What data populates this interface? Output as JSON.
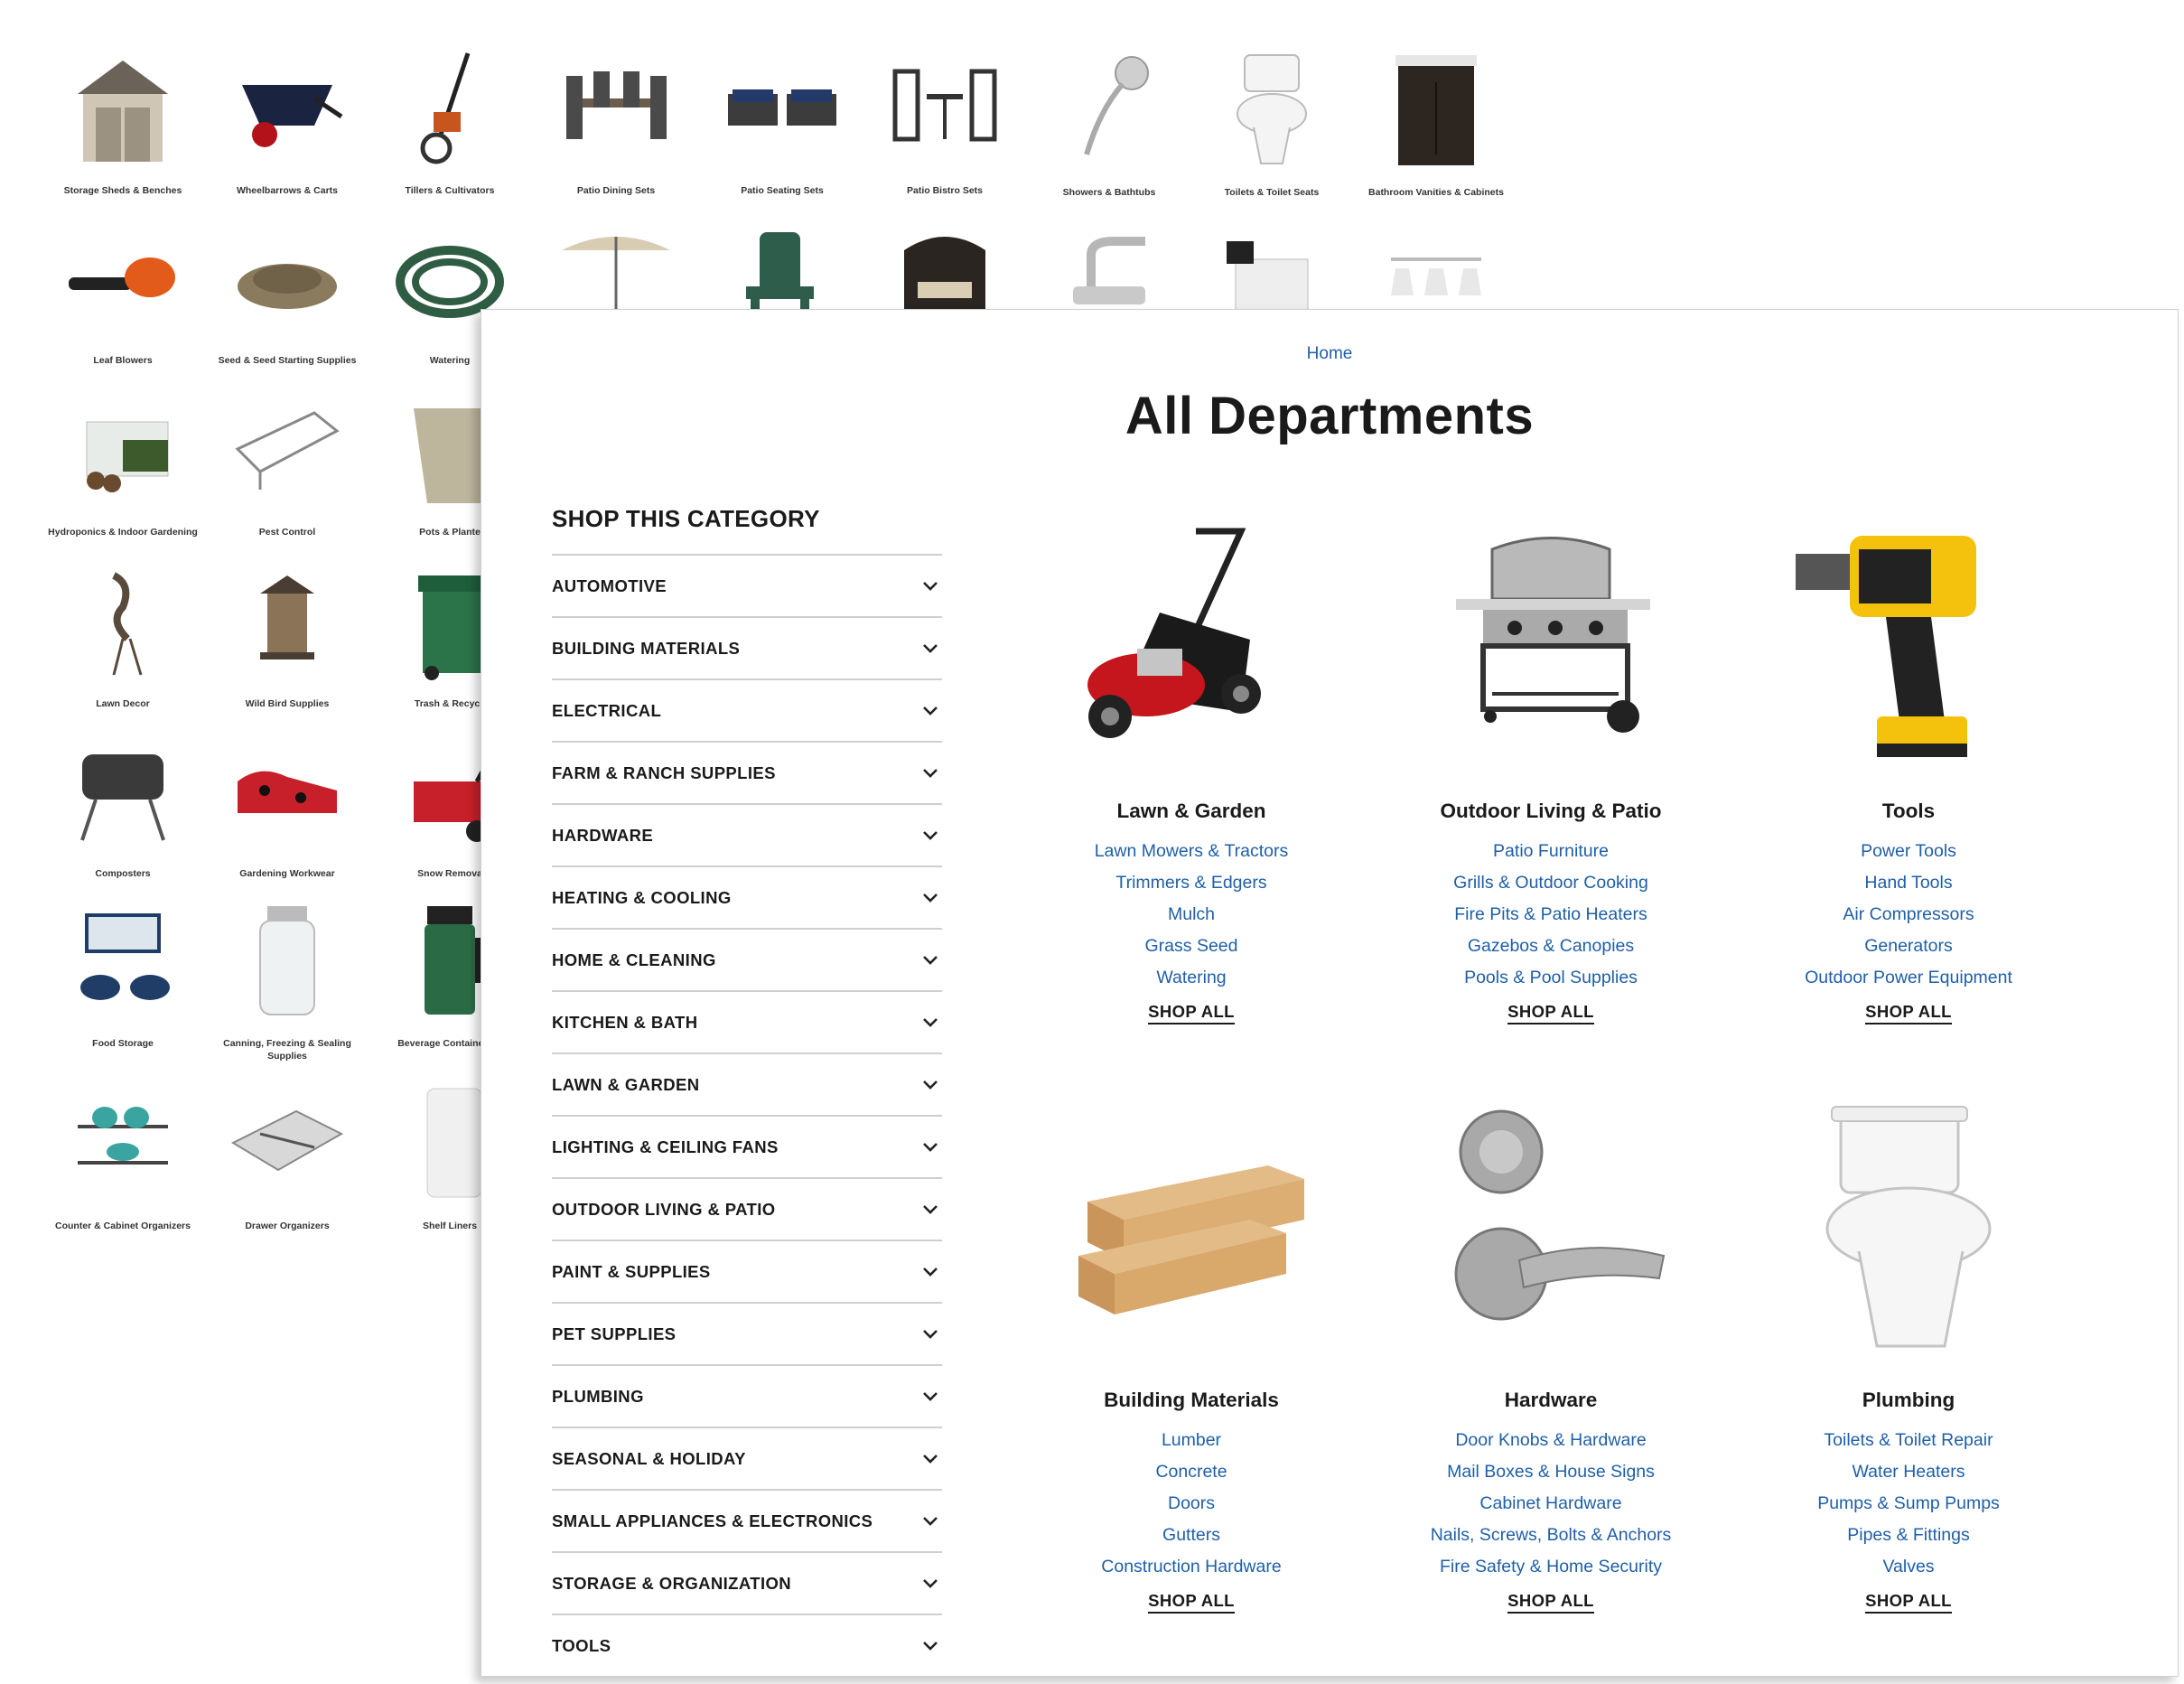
{
  "background_grid": {
    "tiles": [
      {
        "caption": "Storage Sheds & Benches",
        "icon": "shed-icon"
      },
      {
        "caption": "Wheelbarrows & Carts",
        "icon": "wheelbarrow-icon"
      },
      {
        "caption": "Tillers & Cultivators",
        "icon": "tiller-icon"
      },
      {
        "caption": "Patio Dining Sets",
        "icon": "patio-dining-icon"
      },
      {
        "caption": "Patio Seating Sets",
        "icon": "patio-seating-icon"
      },
      {
        "caption": "Patio Bistro Sets",
        "icon": "bistro-set-icon"
      },
      {
        "caption": "Showers & Bathtubs",
        "icon": "shower-head-icon"
      },
      {
        "caption": "Toilets & Toilet Seats",
        "icon": "toilet-icon"
      },
      {
        "caption": "Bathroom Vanities & Cabinets",
        "icon": "vanity-icon"
      },
      {
        "caption": "Leaf Blowers",
        "icon": "leaf-blower-icon"
      },
      {
        "caption": "Seed & Seed Starting Supplies",
        "icon": "seed-icon"
      },
      {
        "caption": "Watering",
        "icon": "hose-icon"
      },
      {
        "caption": "",
        "icon": "umbrella-icon"
      },
      {
        "caption": "",
        "icon": "adirondack-chair-icon"
      },
      {
        "caption": "",
        "icon": "wicker-chair-icon"
      },
      {
        "caption": "",
        "icon": "faucet-icon"
      },
      {
        "caption": "",
        "icon": "exhaust-fan-icon"
      },
      {
        "caption": "",
        "icon": "vanity-light-icon"
      },
      {
        "caption": "Hydroponics & Indoor Gardening",
        "icon": "seed-tray-icon"
      },
      {
        "caption": "Pest Control",
        "icon": "trap-icon"
      },
      {
        "caption": "Pots & Plante",
        "icon": "planter-icon"
      },
      {
        "caption": "Lawn Decor",
        "icon": "heron-statue-icon"
      },
      {
        "caption": "Wild Bird Supplies",
        "icon": "bird-feeder-icon"
      },
      {
        "caption": "Trash & Recycli",
        "icon": "trash-can-icon"
      },
      {
        "caption": "Composters",
        "icon": "composter-icon"
      },
      {
        "caption": "Gardening Workwear",
        "icon": "garden-shoe-icon"
      },
      {
        "caption": "Snow Remova",
        "icon": "snow-blower-icon"
      },
      {
        "caption": "Food Storage",
        "icon": "food-container-icon"
      },
      {
        "caption": "Canning, Freezing & Sealing Supplies",
        "icon": "mason-jar-icon"
      },
      {
        "caption": "Beverage Containers &",
        "icon": "thermos-icon"
      },
      {
        "caption": "Counter & Cabinet Organizers",
        "icon": "shelf-organizer-icon"
      },
      {
        "caption": "Drawer Organizers",
        "icon": "drawer-organizer-icon"
      },
      {
        "caption": "Shelf Liners",
        "icon": "shelf-liner-icon"
      }
    ]
  },
  "breadcrumb": {
    "home": "Home"
  },
  "page": {
    "title": "All Departments"
  },
  "sidebar": {
    "heading": "SHOP THIS CATEGORY",
    "items": [
      "AUTOMOTIVE",
      "BUILDING MATERIALS",
      "ELECTRICAL",
      "FARM & RANCH SUPPLIES",
      "HARDWARE",
      "HEATING & COOLING",
      "HOME & CLEANING",
      "KITCHEN & BATH",
      "LAWN & GARDEN",
      "LIGHTING & CEILING FANS",
      "OUTDOOR LIVING & PATIO",
      "PAINT & SUPPLIES",
      "PET SUPPLIES",
      "PLUMBING",
      "SEASONAL & HOLIDAY",
      "SMALL APPLIANCES & ELECTRONICS",
      "STORAGE & ORGANIZATION",
      "TOOLS"
    ]
  },
  "departments": [
    {
      "name": "Lawn & Garden",
      "icon": "lawn-mower-icon",
      "links": [
        "Lawn Mowers & Tractors",
        "Trimmers & Edgers",
        "Mulch",
        "Grass Seed",
        "Watering"
      ],
      "shop_all": "SHOP ALL"
    },
    {
      "name": "Outdoor Living & Patio",
      "icon": "grill-icon",
      "links": [
        "Patio Furniture",
        "Grills & Outdoor Cooking",
        "Fire Pits & Patio Heaters",
        "Gazebos & Canopies",
        "Pools & Pool Supplies"
      ],
      "shop_all": "SHOP ALL"
    },
    {
      "name": "Tools",
      "icon": "drill-icon",
      "links": [
        "Power Tools",
        "Hand Tools",
        "Air Compressors",
        "Generators",
        "Outdoor Power Equipment"
      ],
      "shop_all": "SHOP ALL"
    },
    {
      "name": "Building Materials",
      "icon": "lumber-icon",
      "links": [
        "Lumber",
        "Concrete",
        "Doors",
        "Gutters",
        "Construction Hardware"
      ],
      "shop_all": "SHOP ALL"
    },
    {
      "name": "Hardware",
      "icon": "door-lock-icon",
      "links": [
        "Door Knobs & Hardware",
        "Mail Boxes & House Signs",
        "Cabinet Hardware",
        "Nails, Screws, Bolts & Anchors",
        "Fire Safety & Home Security"
      ],
      "shop_all": "SHOP ALL"
    },
    {
      "name": "Plumbing",
      "icon": "toilet-icon",
      "links": [
        "Toilets & Toilet Repair",
        "Water Heaters",
        "Pumps & Sump Pumps",
        "Pipes & Fittings",
        "Valves"
      ],
      "shop_all": "SHOP ALL"
    }
  ],
  "colors": {
    "link": "#1f5fa8",
    "text": "#1a1a1a",
    "divider": "#cfcfcf"
  }
}
